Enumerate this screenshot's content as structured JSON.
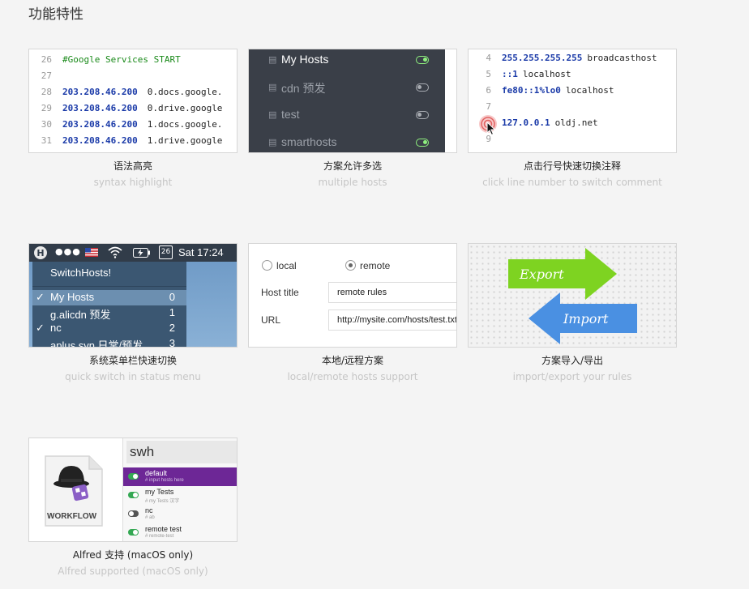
{
  "page": {
    "title": "功能特性"
  },
  "features": [
    {
      "title": "语法高亮",
      "subtitle": "syntax highlight"
    },
    {
      "title": "方案允许多选",
      "subtitle": "multiple hosts"
    },
    {
      "title": "点击行号快速切换注释",
      "subtitle": "click line number to switch comment"
    },
    {
      "title": "系统菜单栏快速切换",
      "subtitle": "quick switch in status menu"
    },
    {
      "title": "本地/远程方案",
      "subtitle": "local/remote hosts support"
    },
    {
      "title": "方案导入/导出",
      "subtitle": "import/export your rules"
    },
    {
      "title": "Alfred 支持 (macOS only)",
      "subtitle": "Alfred supported (macOS only)"
    }
  ],
  "syntax": {
    "lines": [
      {
        "n": "26",
        "comment": "#Google Services START"
      },
      {
        "n": "27"
      },
      {
        "n": "28",
        "ip": "203.208.46.200",
        "host": "0.docs.google."
      },
      {
        "n": "29",
        "ip": "203.208.46.200",
        "host": "0.drive.google"
      },
      {
        "n": "30",
        "ip": "203.208.46.200",
        "host": "1.docs.google."
      },
      {
        "n": "31",
        "ip": "203.208.46.200",
        "host": "1.drive.google"
      }
    ]
  },
  "hosts_list": [
    {
      "name": "My Hosts",
      "on": true
    },
    {
      "name": "cdn 预发",
      "on": false
    },
    {
      "name": "test",
      "on": false
    },
    {
      "name": "smarthosts",
      "on": true
    }
  ],
  "comment_demo": {
    "lines": [
      {
        "n": "4",
        "ip": "255.255.255.255",
        "host": "broadcasthost"
      },
      {
        "n": "5",
        "ip": "::1",
        "host": "localhost"
      },
      {
        "n": "6",
        "ip": "fe80::1%lo0",
        "host": "localhost"
      },
      {
        "n": "7"
      },
      {
        "n": "8",
        "ip": "127.0.0.1",
        "host": "oldj.net"
      },
      {
        "n": "9"
      }
    ]
  },
  "status_menu": {
    "time": "Sat 17:24",
    "date_num": "26",
    "title": "SwitchHosts!",
    "items": [
      {
        "label": "My Hosts",
        "num": "0",
        "checked": true,
        "selected": true
      },
      {
        "label": "g.alicdn 预发",
        "num": "1",
        "checked": false
      },
      {
        "label": "nc",
        "num": "2",
        "checked": true
      },
      {
        "label": "aplus svn 日常/预发",
        "num": "3",
        "checked": false
      }
    ]
  },
  "local_remote": {
    "local_label": "local",
    "remote_label": "remote",
    "host_title_label": "Host title",
    "host_title_value": "remote rules",
    "url_label": "URL",
    "url_value": "http://mysite.com/hosts/test.txt"
  },
  "import_export": {
    "export_label": "Export",
    "import_label": "Import"
  },
  "alfred": {
    "workflow_label": "WORKFLOW",
    "query": "swh",
    "items": [
      {
        "title": "default",
        "sub": "# input hosts here",
        "on": true,
        "selected": true
      },
      {
        "title": "my Tests",
        "sub": "# my Tests 汉字",
        "on": true
      },
      {
        "title": "nc",
        "sub": "# ab",
        "on": false
      },
      {
        "title": "remote test",
        "sub": "# remote-test",
        "on": true
      }
    ]
  },
  "colors": {
    "export_arrow": "#7ed321",
    "import_arrow": "#4a90e2",
    "alfred_selected": "#6d2796"
  }
}
